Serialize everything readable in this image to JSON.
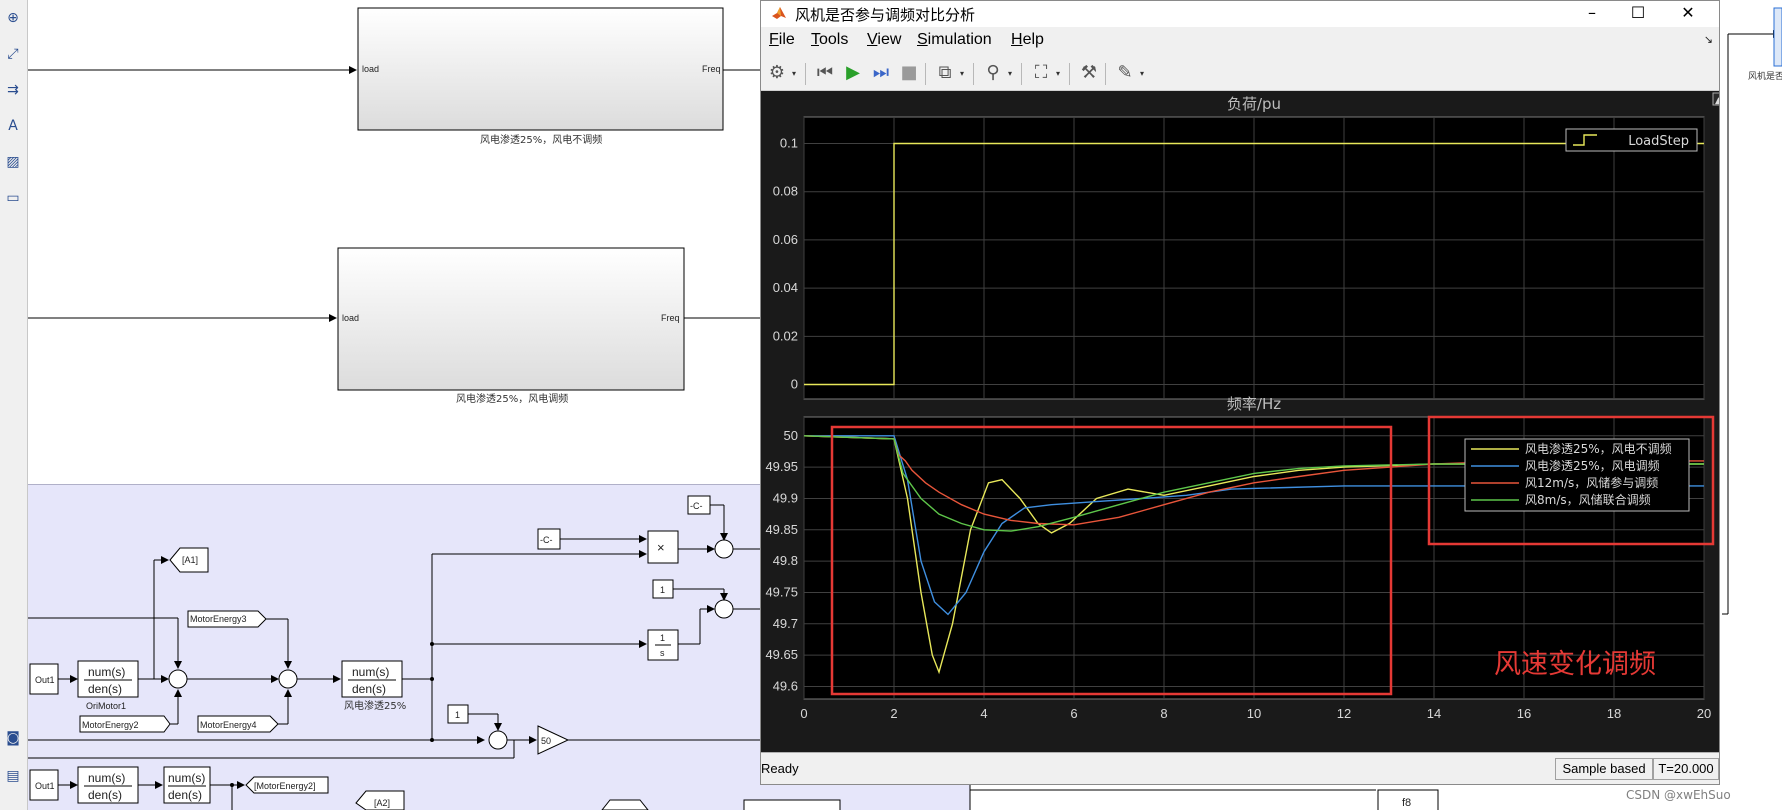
{
  "scope_window": {
    "title": "风机是否参与调频对比分析",
    "menu": [
      {
        "key": "F",
        "rest": "ile"
      },
      {
        "key": "T",
        "rest": "ools"
      },
      {
        "key": "V",
        "rest": "iew"
      },
      {
        "key": "S",
        "rest": "imulation"
      },
      {
        "key": "H",
        "rest": "elp"
      }
    ],
    "toolbar_icons": [
      "gear-icon",
      "step-back-icon",
      "run-icon",
      "step-forward-icon",
      "stop-icon",
      "signal-icon",
      "probe-icon",
      "zoom-fit-icon",
      "measure-icon",
      "highlight-icon"
    ],
    "status": "Ready",
    "sample_mode": "Sample based",
    "sim_time": "T=20.000",
    "colors": {
      "plot_bg": "#000000",
      "figure_bg": "#1a1a1a",
      "grid": "#404040",
      "annotation": "#e53935"
    }
  },
  "chart_data": [
    {
      "type": "line",
      "title": "负荷/pu",
      "x_range": [
        0,
        20
      ],
      "ylim": [
        -0.006,
        0.111
      ],
      "x_ticks": [],
      "y_ticks": [
        0,
        0.02,
        0.04,
        0.06,
        0.08,
        0.1
      ],
      "y_tick_labels": [
        "0",
        "0.02",
        "0.04",
        "0.06",
        "0.08",
        "0.1"
      ],
      "grid": true,
      "legend_position": "top-right",
      "series": [
        {
          "name": "LoadStep",
          "color": "#e8e85a",
          "points": [
            [
              0,
              0
            ],
            [
              2,
              0
            ],
            [
              2,
              0.1
            ],
            [
              20,
              0.1
            ]
          ]
        }
      ]
    },
    {
      "type": "line",
      "title": "频率/Hz",
      "x_range": [
        0,
        20
      ],
      "ylim": [
        49.58,
        50.03
      ],
      "x_ticks": [
        0,
        2,
        4,
        6,
        8,
        10,
        12,
        14,
        16,
        18,
        20
      ],
      "y_ticks": [
        49.6,
        49.65,
        49.7,
        49.75,
        49.8,
        49.85,
        49.9,
        49.95,
        50
      ],
      "y_tick_labels": [
        "49.6",
        "49.65",
        "49.7",
        "49.75",
        "49.8",
        "49.85",
        "49.9",
        "49.95",
        "50"
      ],
      "grid": true,
      "legend_position": "top-right",
      "annotation": "风速变化调频",
      "series": [
        {
          "name": "风电渗透25%，风电不调频",
          "color": "#e8e85a",
          "points": [
            [
              0,
              50
            ],
            [
              2,
              49.995
            ],
            [
              2.3,
              49.9
            ],
            [
              2.6,
              49.75
            ],
            [
              2.85,
              49.65
            ],
            [
              3.0,
              49.623
            ],
            [
              3.3,
              49.7
            ],
            [
              3.7,
              49.85
            ],
            [
              4.1,
              49.925
            ],
            [
              4.4,
              49.93
            ],
            [
              4.8,
              49.9
            ],
            [
              5.2,
              49.86
            ],
            [
              5.5,
              49.845
            ],
            [
              5.9,
              49.86
            ],
            [
              6.5,
              49.9
            ],
            [
              7.2,
              49.915
            ],
            [
              8,
              49.905
            ],
            [
              9,
              49.92
            ],
            [
              10,
              49.935
            ],
            [
              11,
              49.945
            ],
            [
              12,
              49.95
            ],
            [
              14,
              49.955
            ],
            [
              16,
              49.955
            ],
            [
              18,
              49.955
            ],
            [
              20,
              49.955
            ]
          ]
        },
        {
          "name": "风电渗透25%，风电调频",
          "color": "#3f8fe0",
          "points": [
            [
              0,
              50
            ],
            [
              2,
              50
            ],
            [
              2.3,
              49.93
            ],
            [
              2.6,
              49.8
            ],
            [
              2.9,
              49.735
            ],
            [
              3.2,
              49.715
            ],
            [
              3.6,
              49.75
            ],
            [
              4.0,
              49.815
            ],
            [
              4.4,
              49.86
            ],
            [
              4.9,
              49.885
            ],
            [
              5.5,
              49.89
            ],
            [
              6.5,
              49.895
            ],
            [
              7.5,
              49.9
            ],
            [
              8.5,
              49.905
            ],
            [
              9.5,
              49.915
            ],
            [
              12,
              49.92
            ],
            [
              14,
              49.92
            ],
            [
              16,
              49.92
            ],
            [
              18,
              49.92
            ],
            [
              20,
              49.92
            ]
          ]
        },
        {
          "name": "风12m/s，风储参与调频",
          "color": "#e8553a",
          "points": [
            [
              0,
              50
            ],
            [
              2,
              49.995
            ],
            [
              2.1,
              49.97
            ],
            [
              2.25,
              49.96
            ],
            [
              2.4,
              49.945
            ],
            [
              2.7,
              49.925
            ],
            [
              3.0,
              49.91
            ],
            [
              3.5,
              49.89
            ],
            [
              4.0,
              49.875
            ],
            [
              4.6,
              49.865
            ],
            [
              5.2,
              49.86
            ],
            [
              6,
              49.858
            ],
            [
              7,
              49.87
            ],
            [
              8,
              49.89
            ],
            [
              9,
              49.91
            ],
            [
              10,
              49.925
            ],
            [
              11,
              49.935
            ],
            [
              12,
              49.945
            ],
            [
              14,
              49.955
            ],
            [
              16,
              49.96
            ],
            [
              18,
              49.96
            ],
            [
              20,
              49.96
            ]
          ]
        },
        {
          "name": "风8m/s，风储联合调频",
          "color": "#5ec64a",
          "points": [
            [
              0,
              50
            ],
            [
              2,
              49.995
            ],
            [
              2.2,
              49.94
            ],
            [
              2.6,
              49.9
            ],
            [
              3.0,
              49.875
            ],
            [
              3.5,
              49.86
            ],
            [
              4.0,
              49.85
            ],
            [
              4.6,
              49.848
            ],
            [
              5.2,
              49.855
            ],
            [
              6,
              49.87
            ],
            [
              7,
              49.89
            ],
            [
              8,
              49.91
            ],
            [
              9,
              49.925
            ],
            [
              10,
              49.94
            ],
            [
              11,
              49.948
            ],
            [
              12,
              49.952
            ],
            [
              14,
              49.955
            ],
            [
              16,
              49.955
            ],
            [
              18,
              49.955
            ],
            [
              20,
              49.955
            ]
          ]
        }
      ]
    }
  ],
  "simulink": {
    "subsystem1": {
      "in_port": "load",
      "out_port": "Freq",
      "caption": "风电渗透25%，风电不调频"
    },
    "subsystem2": {
      "in_port": "load",
      "out_port": "Freq",
      "caption": "风电渗透25%，风电调频"
    },
    "blocks": {
      "out1": "Out1",
      "tf_num": "num(s)",
      "tf_den": "den(s)",
      "ori_motor": "OriMotor1",
      "tf_caption": "风电渗透25%",
      "goto_a1": "[A1]",
      "goto_a2": "[A2]",
      "motor_energy2": "MotorEnergy2",
      "motor_energy3": "MotorEnergy3",
      "motor_energy4": "MotorEnergy4",
      "motor_energy2_goto": "[MotorEnergy2]",
      "const_c": "-C-",
      "const_one": "1",
      "integrator_num": "1",
      "integrator_den": "s",
      "product": "×",
      "gain": "50",
      "f8": "f8",
      "right_label": "风机是否"
    }
  },
  "watermark": "CSDN @xwEhSuo"
}
